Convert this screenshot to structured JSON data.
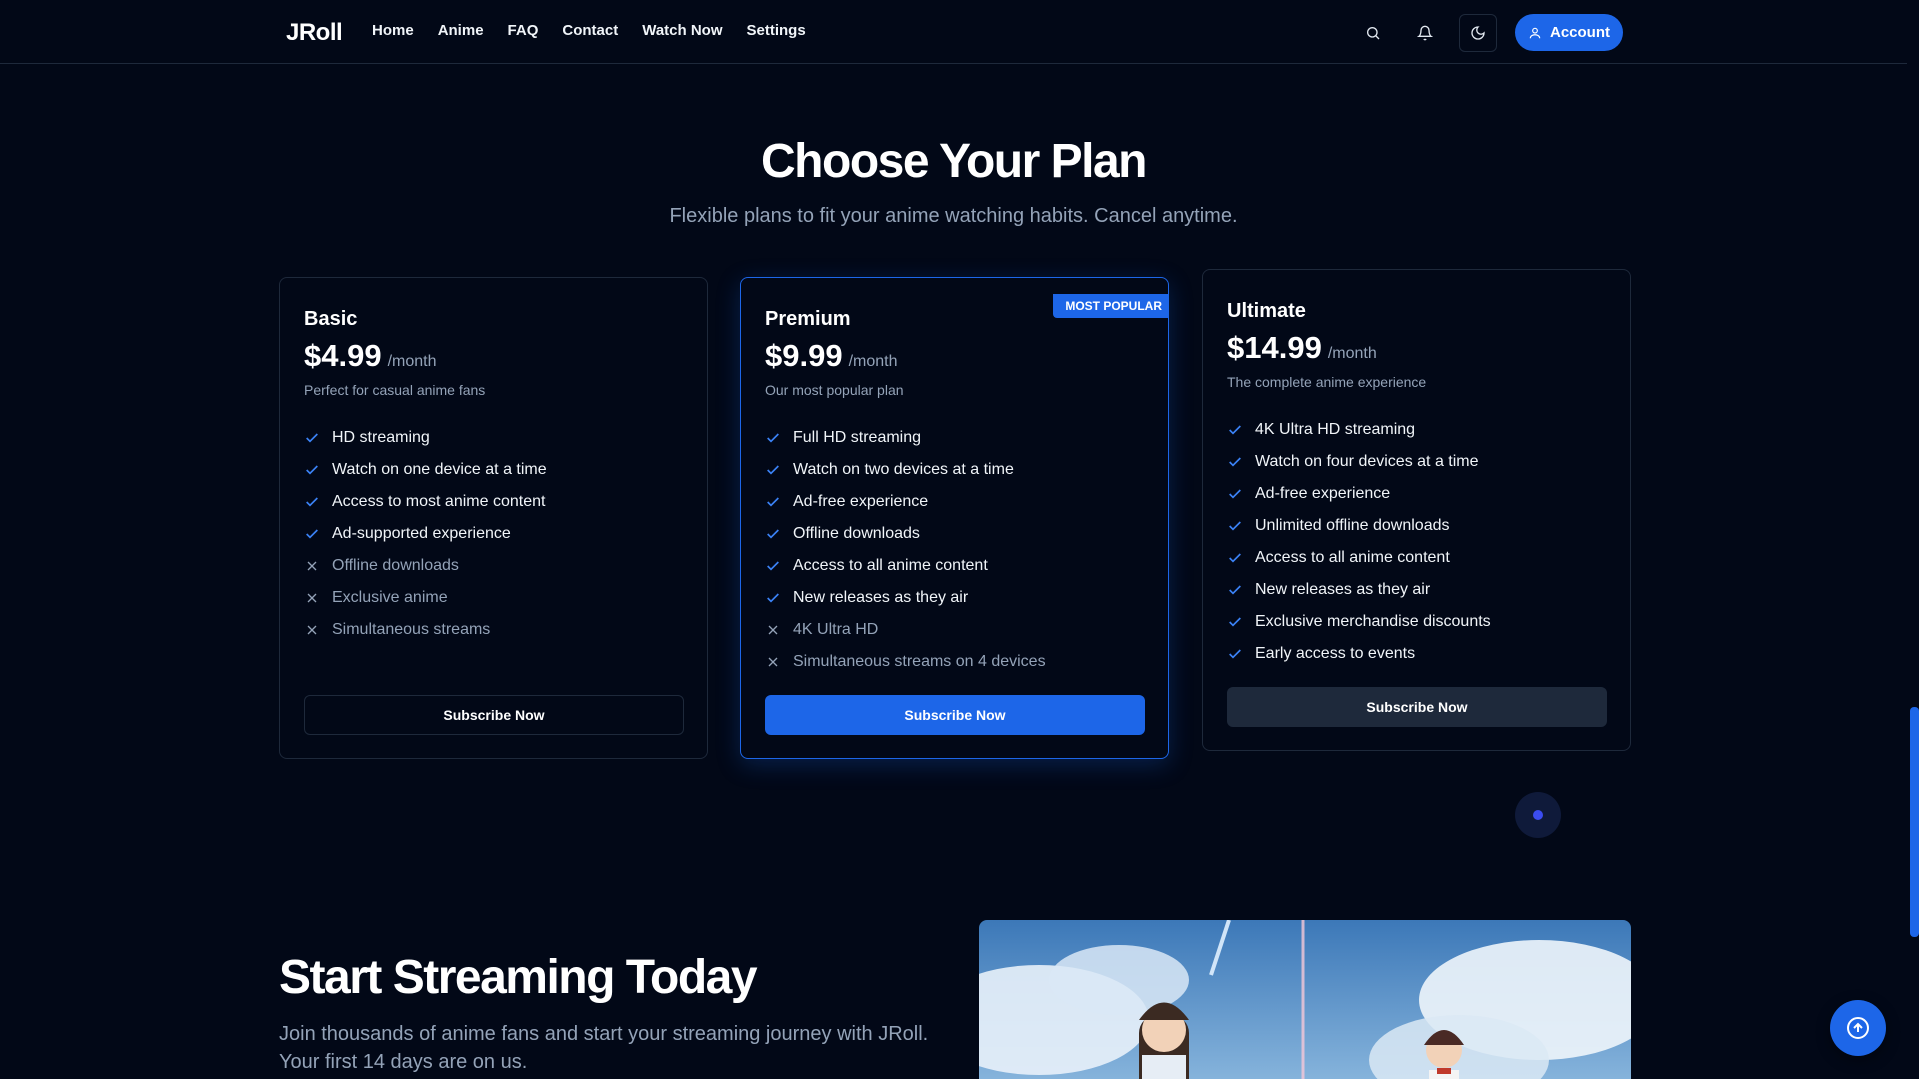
{
  "nav": {
    "logo": "JRoll",
    "links": [
      "Home",
      "Anime",
      "FAQ",
      "Contact",
      "Watch Now",
      "Settings"
    ],
    "account_label": "Account",
    "icons": [
      "search-icon",
      "bell-icon",
      "moon-icon",
      "user-icon"
    ]
  },
  "pricing": {
    "title": "Choose Your Plan",
    "subtitle": "Flexible plans to fit your anime watching habits. Cancel anytime.",
    "plans": [
      {
        "name": "Basic",
        "price": "$4.99",
        "period": "/month",
        "tagline": "Perfect for casual anime fans",
        "features": [
          {
            "text": "HD streaming",
            "included": true
          },
          {
            "text": "Watch on one device at a time",
            "included": true
          },
          {
            "text": "Access to most anime content",
            "included": true
          },
          {
            "text": "Ad-supported experience",
            "included": true
          },
          {
            "text": "Offline downloads",
            "included": false
          },
          {
            "text": "Exclusive anime",
            "included": false
          },
          {
            "text": "Simultaneous streams",
            "included": false
          }
        ],
        "button": "Subscribe Now"
      },
      {
        "name": "Premium",
        "price": "$9.99",
        "period": "/month",
        "tagline": "Our most popular plan",
        "badge": "MOST POPULAR",
        "features": [
          {
            "text": "Full HD streaming",
            "included": true
          },
          {
            "text": "Watch on two devices at a time",
            "included": true
          },
          {
            "text": "Ad-free experience",
            "included": true
          },
          {
            "text": "Offline downloads",
            "included": true
          },
          {
            "text": "Access to all anime content",
            "included": true
          },
          {
            "text": "New releases as they air",
            "included": true
          },
          {
            "text": "4K Ultra HD",
            "included": false
          },
          {
            "text": "Simultaneous streams on 4 devices",
            "included": false
          }
        ],
        "button": "Subscribe Now"
      },
      {
        "name": "Ultimate",
        "price": "$14.99",
        "period": "/month",
        "tagline": "The complete anime experience",
        "features": [
          {
            "text": "4K Ultra HD streaming",
            "included": true
          },
          {
            "text": "Watch on four devices at a time",
            "included": true
          },
          {
            "text": "Ad-free experience",
            "included": true
          },
          {
            "text": "Unlimited offline downloads",
            "included": true
          },
          {
            "text": "Access to all anime content",
            "included": true
          },
          {
            "text": "New releases as they air",
            "included": true
          },
          {
            "text": "Exclusive merchandise discounts",
            "included": true
          },
          {
            "text": "Early access to events",
            "included": true
          }
        ],
        "button": "Subscribe Now"
      }
    ]
  },
  "streaming": {
    "title": "Start Streaming Today",
    "text_line1": "Join thousands of anime fans and start your streaming journey with JRoll.",
    "text_line2": "Your first 14 days are on us."
  },
  "colors": {
    "background": "#020817",
    "accent": "#1d66e8",
    "muted_text": "#94a3b8",
    "border": "#1e293b"
  }
}
